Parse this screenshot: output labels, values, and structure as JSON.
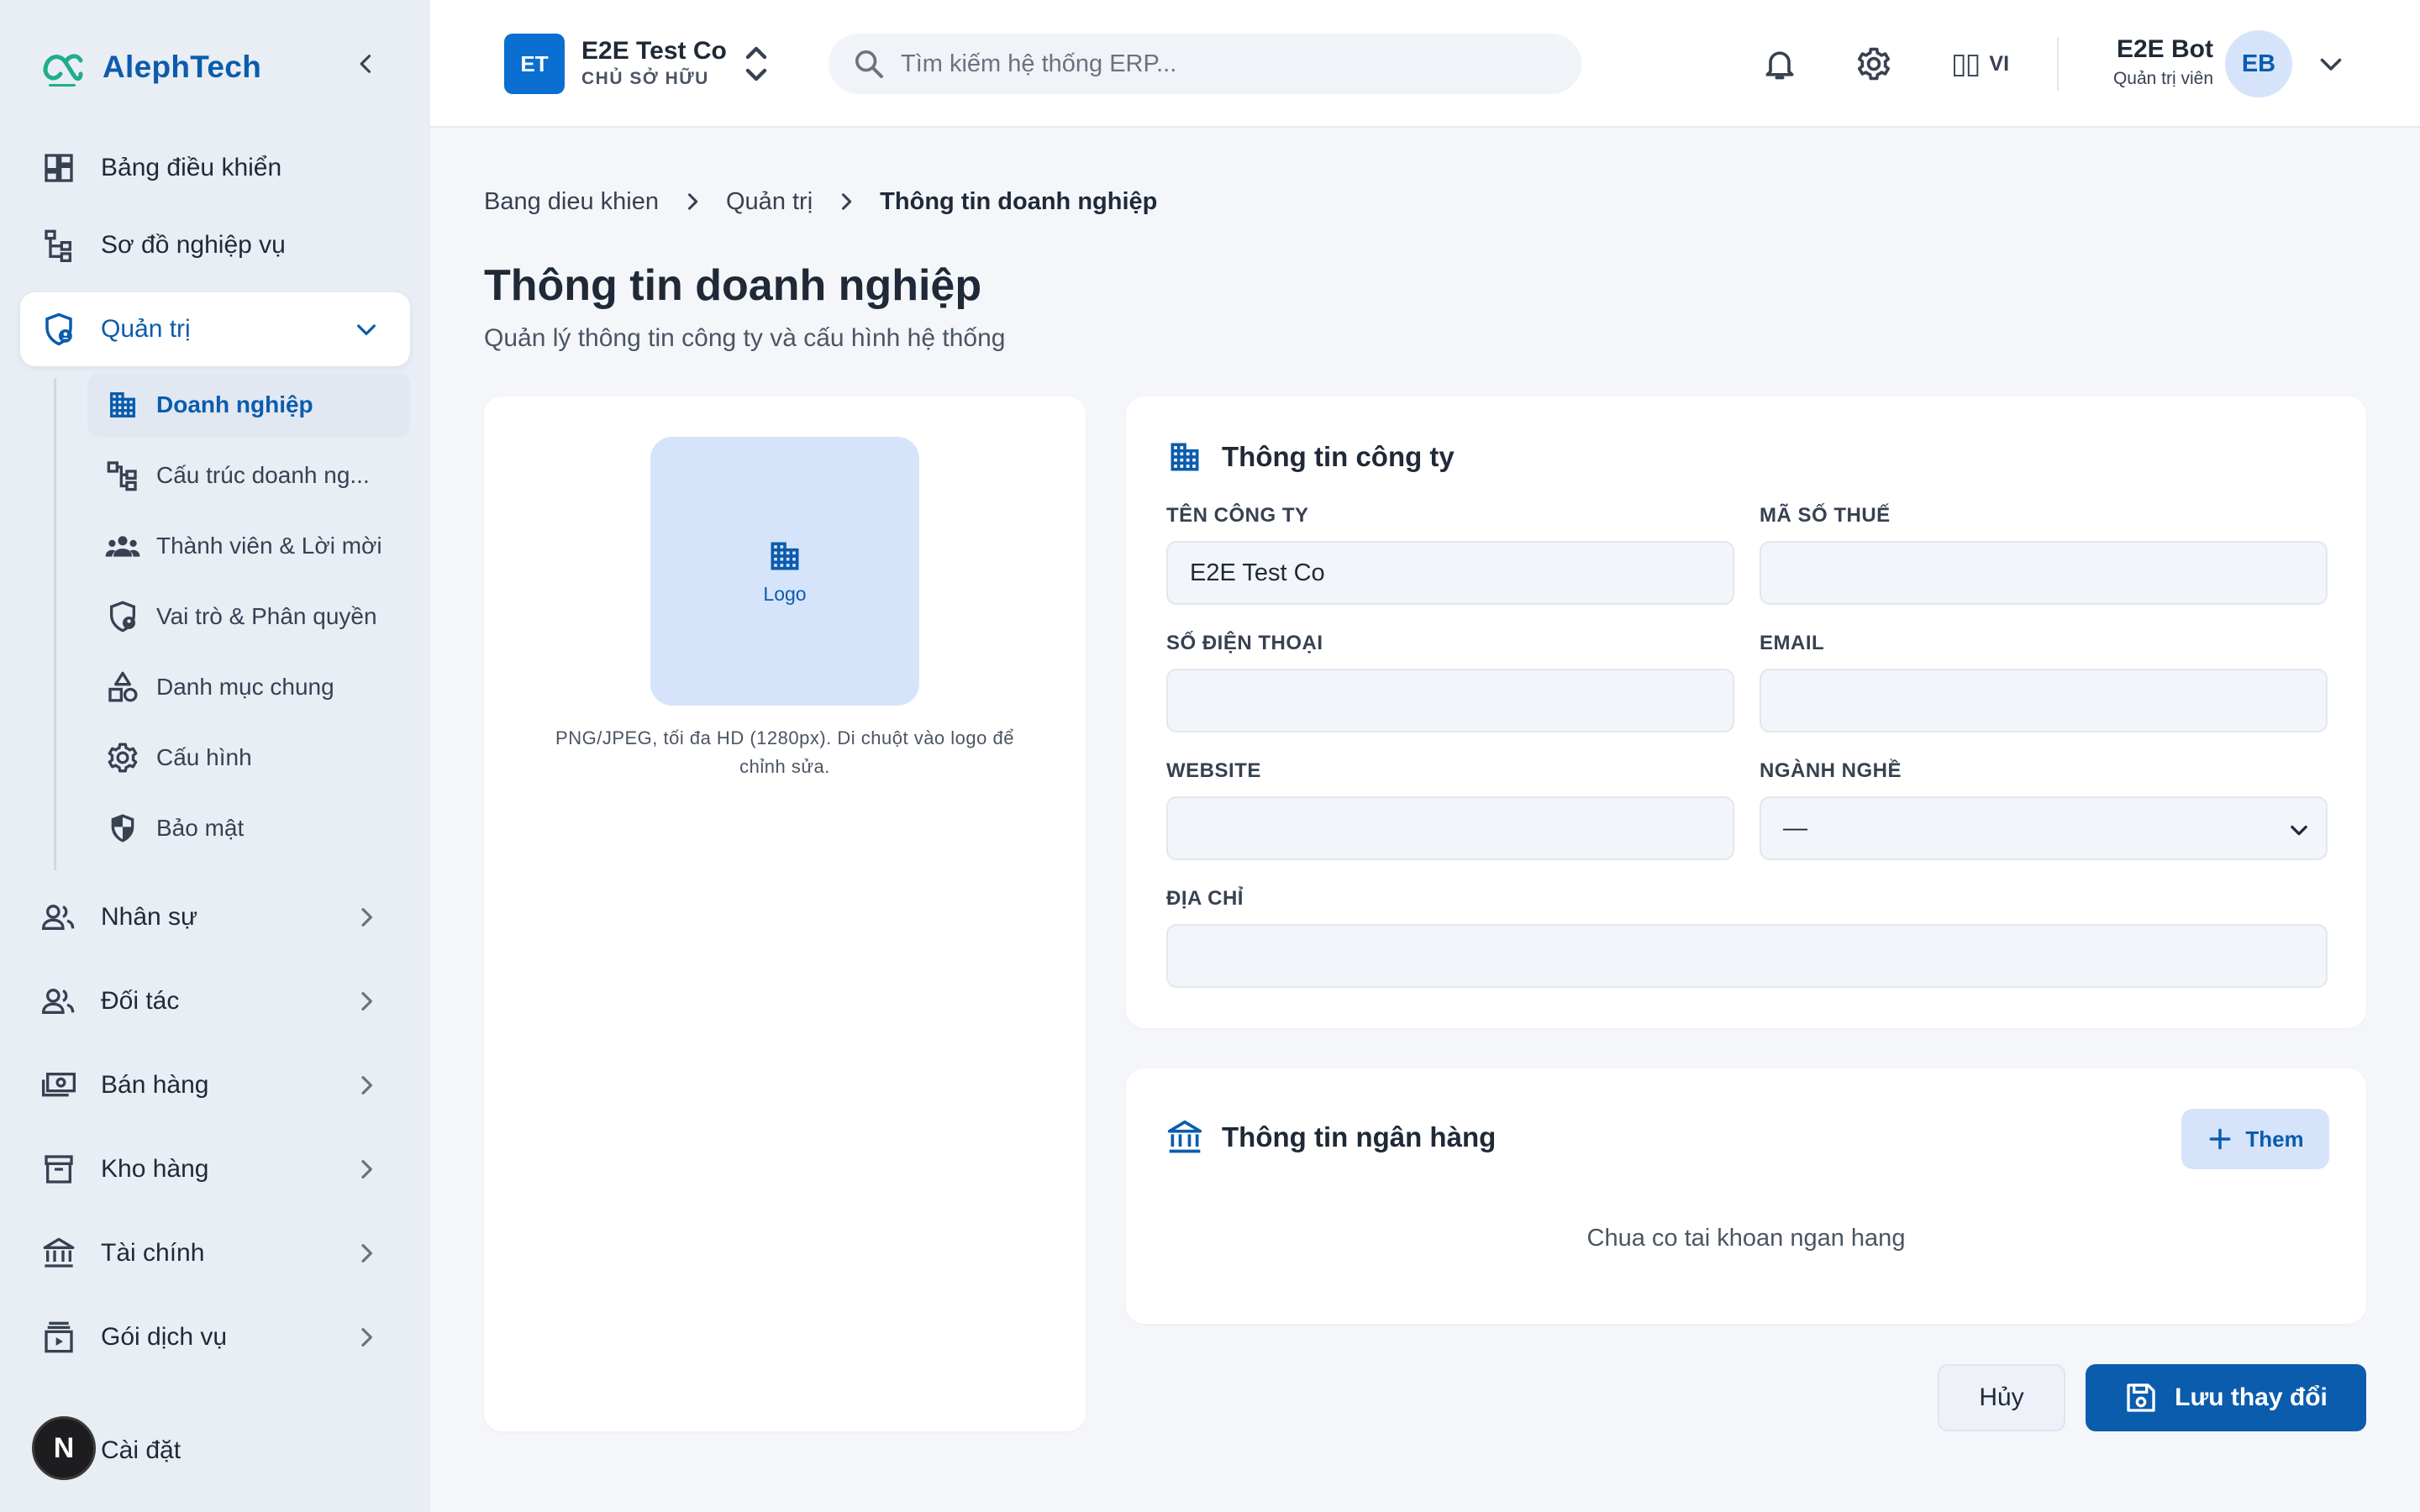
{
  "brand": {
    "name": "AlephTech"
  },
  "sidebar": {
    "items": [
      {
        "label": "Bảng điều khiển",
        "icon": "dashboard-icon"
      },
      {
        "label": "Sơ đồ nghiệp vụ",
        "icon": "flowchart-icon"
      },
      {
        "label": "Quản trị",
        "icon": "admin-shield-icon",
        "expanded": true
      },
      {
        "label": "Nhân sự",
        "icon": "people-icon"
      },
      {
        "label": "Đối tác",
        "icon": "partners-icon"
      },
      {
        "label": "Bán hàng",
        "icon": "cash-icon"
      },
      {
        "label": "Kho hàng",
        "icon": "archive-icon"
      },
      {
        "label": "Tài chính",
        "icon": "bank-icon"
      },
      {
        "label": "Gói dịch vụ",
        "icon": "subscription-icon"
      }
    ],
    "sub_items": [
      {
        "label": "Doanh nghiệp",
        "icon": "building-icon",
        "active": true
      },
      {
        "label": "Cấu trúc doanh ng...",
        "icon": "org-structure-icon"
      },
      {
        "label": "Thành viên & Lời mời",
        "icon": "members-icon"
      },
      {
        "label": "Vai trò & Phân quyền",
        "icon": "role-shield-icon"
      },
      {
        "label": "Danh mục chung",
        "icon": "categories-icon"
      },
      {
        "label": "Cấu hình",
        "icon": "gear-icon"
      },
      {
        "label": "Bảo mật",
        "icon": "security-shield-icon"
      }
    ],
    "footer": {
      "badge": "N",
      "label": "Cài đặt"
    }
  },
  "header": {
    "org": {
      "initials": "ET",
      "name": "E2E Test Co",
      "role": "CHỦ SỞ HỮU"
    },
    "search": {
      "placeholder": "Tìm kiếm hệ thống ERP..."
    },
    "language": {
      "icon_text": "▯▯",
      "code": "VI"
    },
    "user": {
      "name": "E2E Bot",
      "role": "Quản trị viên",
      "initials": "EB"
    }
  },
  "breadcrumb": [
    "Bang dieu khien",
    "Quản trị",
    "Thông tin doanh nghiệp"
  ],
  "page": {
    "title": "Thông tin doanh nghiệp",
    "subtitle": "Quản lý thông tin công ty và cấu hình hệ thống"
  },
  "logo_card": {
    "logo_label": "Logo",
    "hint": "PNG/JPEG, tối đa HD (1280px). Di chuột vào logo để chỉnh sửa."
  },
  "company": {
    "title": "Thông tin công ty",
    "fields": {
      "name": {
        "label": "TÊN CÔNG TY",
        "value": "E2E Test Co"
      },
      "tax": {
        "label": "MÃ SỐ THUẾ",
        "value": ""
      },
      "phone": {
        "label": "SỐ ĐIỆN THOẠI",
        "value": ""
      },
      "email": {
        "label": "EMAIL",
        "value": ""
      },
      "website": {
        "label": "WEBSITE",
        "value": ""
      },
      "industry": {
        "label": "NGÀNH NGHỀ",
        "value": "—"
      },
      "address": {
        "label": "ĐỊA CHỈ",
        "value": ""
      }
    }
  },
  "bank": {
    "title": "Thông tin ngân hàng",
    "add_label": "Them",
    "empty": "Chua co tai khoan ngan hang"
  },
  "actions": {
    "cancel": "Hủy",
    "save": "Lưu thay đổi"
  },
  "colors": {
    "accent": "#0b5cad",
    "sidebar_bg": "#e9eef5",
    "page_bg": "#f4f6fa",
    "badge_bg": "#d6e4fb"
  }
}
